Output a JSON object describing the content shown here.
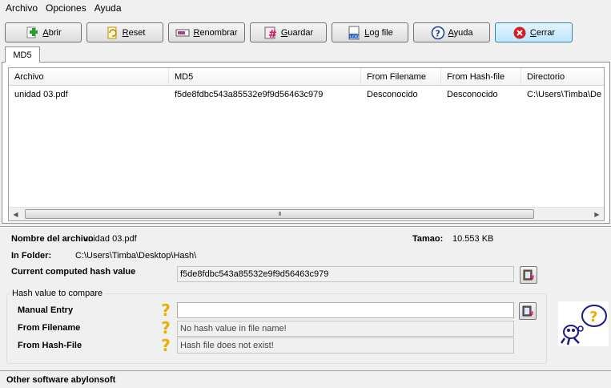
{
  "menu": [
    "Archivo",
    "Opciones",
    "Ayuda"
  ],
  "toolbar": {
    "open_label": "Abrir",
    "reset_label": "Reset",
    "rename_label": "Renombrar",
    "save_label": "Guardar",
    "logfile_label": "Log file",
    "help_label": "Ayuda",
    "close_label": "Cerrar",
    "logfile_icon_text": "LOG"
  },
  "tabs": {
    "active": "MD5"
  },
  "list": {
    "columns": [
      "Archivo",
      "MD5",
      "From Filename",
      "From Hash-file",
      "Directorio"
    ],
    "rows": [
      [
        "unidad 03.pdf",
        "f5de8fdbc543a85532e9f9d56463c979",
        "Desconocido",
        "Desconocido",
        "C:\\Users\\Timba\\De"
      ]
    ],
    "scroll_grip": "III"
  },
  "details": {
    "filename_label": "Nombre del archivo",
    "filename_value": "unidad 03.pdf",
    "size_label": "Tamao:",
    "size_value": "10.553 KB",
    "folder_label": "In Folder:",
    "folder_value": "C:\\Users\\Timba\\Desktop\\Hash\\",
    "computed_label": "Current computed hash value",
    "computed_value": "f5de8fdbc543a85532e9f9d56463c979"
  },
  "compare": {
    "group_title": "Hash value to compare",
    "manual_label": "Manual Entry",
    "manual_value": "",
    "filename_label": "From Filename",
    "filename_value": "No hash value in file name!",
    "hashfile_label": "From Hash-File",
    "hashfile_value": "Hash file does not exist!",
    "qmark": "?"
  },
  "statusbar": {
    "text": "Other software abylonsoft"
  },
  "icons": {
    "open": "plus-document-icon",
    "reset": "reset-document-icon",
    "rename": "rename-icon",
    "save": "hash-save-icon",
    "logfile": "log-file-icon",
    "help": "help-circle-icon",
    "close": "close-circle-icon",
    "copy": "clipboard-hash-icon"
  },
  "colors": {
    "accent": "#3c7fb1",
    "close_red": "#d42020",
    "help_blue": "#1a3e9a",
    "qmark_yellow": "#e8b000"
  }
}
